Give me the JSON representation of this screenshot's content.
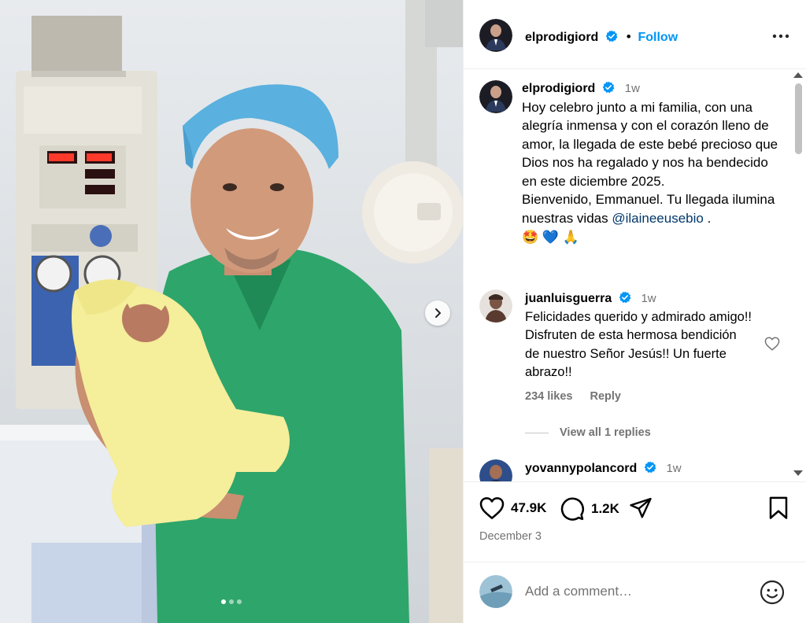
{
  "post": {
    "author": "elprodigiord",
    "follow_label": "Follow",
    "follow_separator": "•",
    "caption_time": "1w",
    "caption_text": "Hoy celebro junto a mi familia, con una alegría inmensa y con el corazón lleno de amor, la llegada de este bebé precioso que Dios nos ha regalado y nos ha bendecido en este diciembre 2025.",
    "caption_text2": "Bienvenido, Emmanuel. Tu llegada ilumina nuestras vidas",
    "caption_mention": "@ilaineeusebio",
    "caption_end": " .",
    "caption_emojis": "🤩 💙 🙏",
    "media_dots": 3,
    "media_active_index": 0
  },
  "comments": [
    {
      "user": "juanluisguerra",
      "time": "1w",
      "text": "Felicidades querido y admirado amigo!! Disfruten de esta hermosa bendición de nuestro Señor Jesús!! Un fuerte abrazo!!",
      "likes": "234 likes",
      "reply_label": "Reply",
      "view_replies": "View all 1 replies"
    },
    {
      "user": "yovannypolancord",
      "time": "1w"
    }
  ],
  "actions": {
    "likes_count": "47.9K",
    "comments_count": "1.2K",
    "date": "December 3"
  },
  "add_comment": {
    "placeholder": "Add a comment…"
  },
  "colors": {
    "accent": "#0095f6",
    "verified": "#0095f6",
    "muted": "#737373",
    "mention": "#00376b"
  },
  "icons": [
    "verified-badge-icon",
    "more-options-icon",
    "heart-icon",
    "comment-icon",
    "share-icon",
    "bookmark-icon",
    "emoji-icon",
    "chevron-right-icon"
  ]
}
